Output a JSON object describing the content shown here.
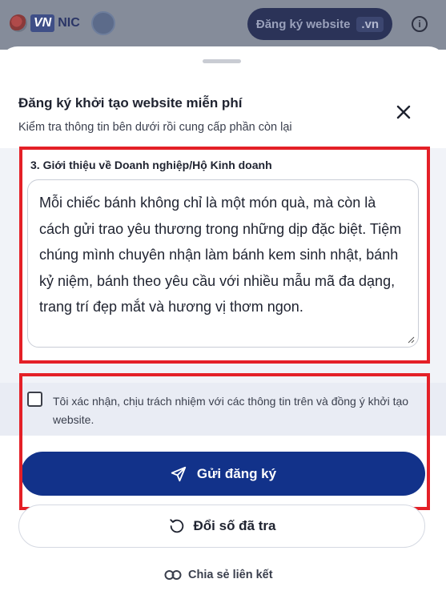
{
  "header": {
    "logo_vn": "VN",
    "logo_nic": "NIC",
    "register_website_label": "Đăng ký website",
    "register_website_tld": ".vn"
  },
  "sheet": {
    "title": "Đăng ký khởi tạo website miễn phí",
    "subtitle": "Kiểm tra thông tin bên dưới rồi cung cấp phần còn lại",
    "section_label": "3. Giới thiệu về Doanh nghiệp/Hộ Kinh doanh",
    "intro_value": "Mỗi chiếc bánh không chỉ là một món quà, mà còn là cách gửi trao yêu thương trong những dịp đặc biệt. Tiệm chúng mình chuyên nhận làm bánh kem sinh nhật, bánh kỷ niệm, bánh theo yêu cầu với nhiều mẫu mã đa dạng, trang trí đẹp mắt và hương vị thơm ngon.",
    "confirm_text": "Tôi xác nhận, chịu trách nhiệm với các thông tin trên và đồng ý khởi tạo website.",
    "confirm_checked": false,
    "submit_label": "Gửi đăng ký",
    "reset_label": "Đổi số đã tra",
    "share_label": "Chia sẻ liên kết"
  },
  "colors": {
    "primary": "#12328a",
    "highlight": "#e42027",
    "overlay": "#858c9a"
  },
  "icons": {
    "close": "close-icon",
    "send": "send-icon",
    "reset": "rotate-ccw-icon",
    "share": "link-icon",
    "info": "info-icon"
  }
}
